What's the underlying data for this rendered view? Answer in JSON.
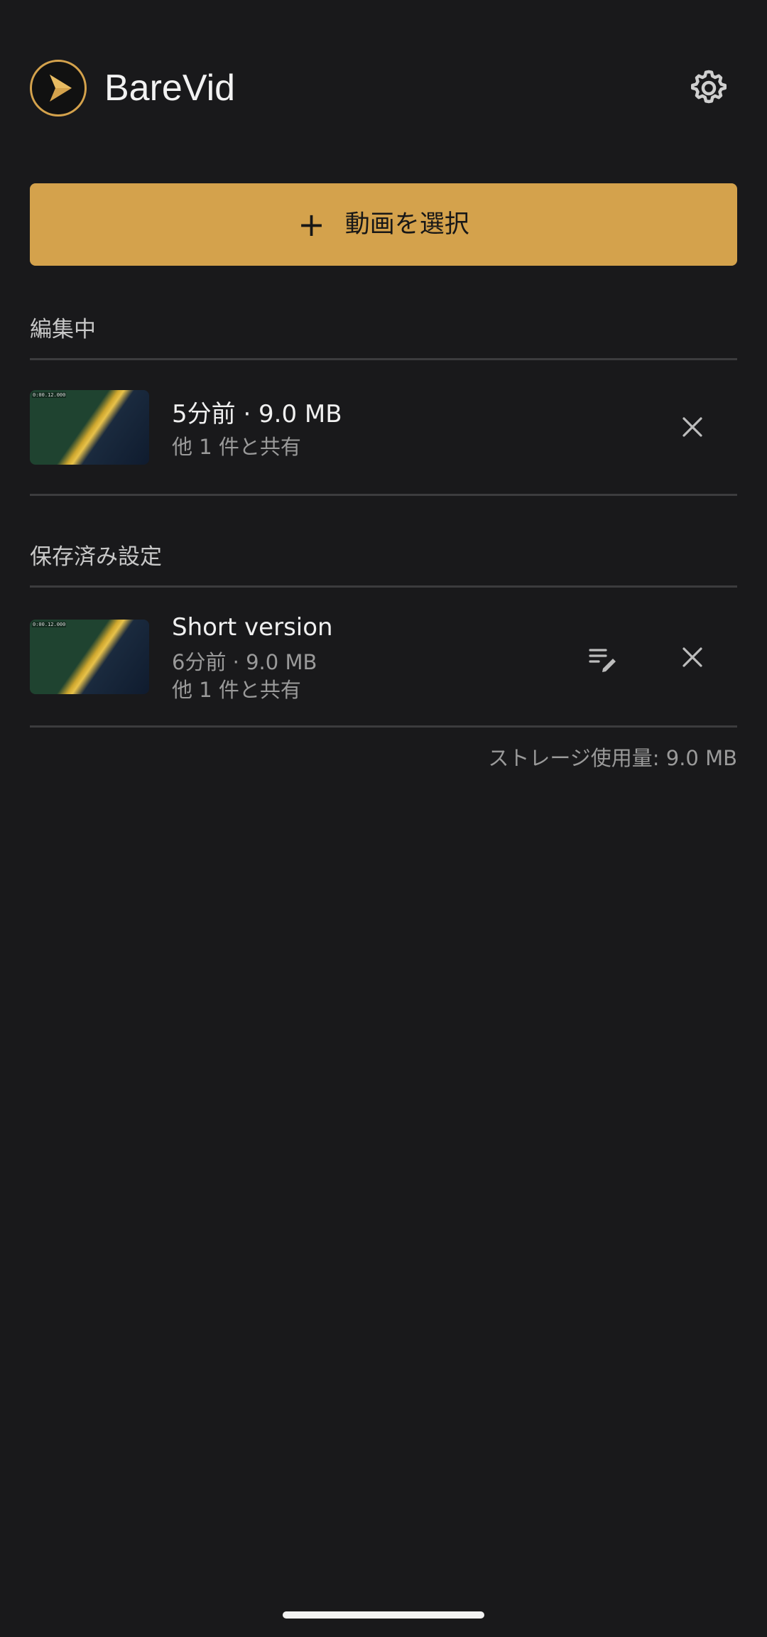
{
  "app": {
    "title": "BareVid",
    "icons": {
      "logo": "play-logo-icon",
      "settings": "gear-icon"
    },
    "accent_color": "#d4a24c"
  },
  "actions": {
    "select_video_label": "動画を選択",
    "plus_glyph": "+"
  },
  "editing": {
    "section_title": "編集中",
    "items": [
      {
        "thumb_timestamp": "0:00.12.000",
        "primary": "5分前 · 9.0 MB",
        "secondary": "他 1 件と共有"
      }
    ]
  },
  "saved": {
    "section_title": "保存済み設定",
    "items": [
      {
        "thumb_timestamp": "0:00.12.000",
        "name": "Short version",
        "meta": "6分前 · 9.0 MB",
        "secondary": "他 1 件と共有"
      }
    ]
  },
  "storage_usage": "ストレージ使用量: 9.0 MB"
}
